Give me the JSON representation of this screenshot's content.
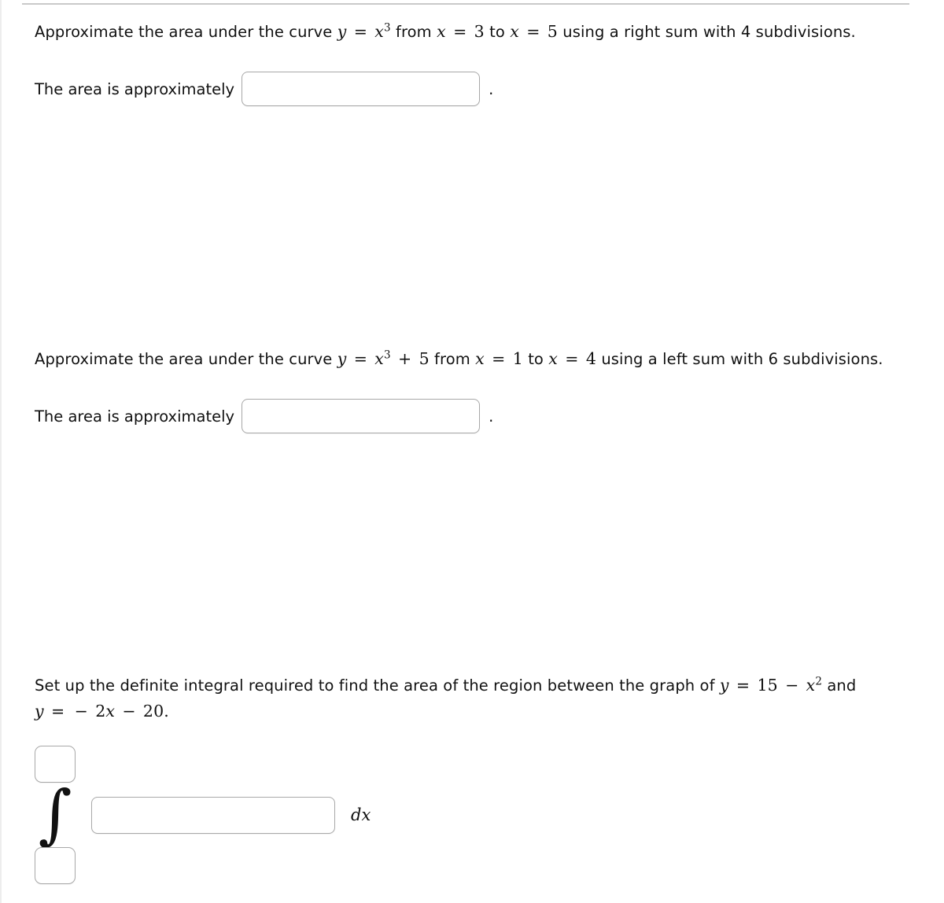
{
  "page": {
    "background_color": "#ffffff",
    "text_color": "#111111",
    "border_color": "#a8a8a8"
  },
  "questions": [
    {
      "id": "q1",
      "prompt_parts": {
        "lead": "Approximate the area under the curve",
        "function_y": "y",
        "equals": "=",
        "function_base": "x",
        "function_exponent": "3",
        "from": "from",
        "var_from": "x",
        "from_value": "3",
        "to": "to",
        "var_to": "x",
        "to_value": "5",
        "tail": "using a right sum with 4 subdivisions."
      },
      "answer_label": "The area is approximately",
      "answer_value": "",
      "answer_placeholder": "",
      "trailing_period": "."
    },
    {
      "id": "q2",
      "prompt_parts": {
        "lead": "Approximate the area under the curve",
        "function_y": "y",
        "equals": "=",
        "function_base": "x",
        "function_exponent": "3",
        "plus": "+",
        "constant": "5",
        "from": "from",
        "var_from": "x",
        "from_value": "1",
        "to": "to",
        "var_to": "x",
        "to_value": "4",
        "tail": "using a left sum with 6 subdivisions."
      },
      "answer_label": "The area is approximately",
      "answer_value": "",
      "answer_placeholder": "",
      "trailing_period": "."
    }
  ],
  "integral_question": {
    "id": "q3",
    "prompt_parts": {
      "lead": "Set up the definite integral required to find the area of the region between the graph of",
      "curve1_y": "y",
      "equals1": "=",
      "curve1_const": "15",
      "minus1": "−",
      "curve1_base": "x",
      "curve1_exponent": "2",
      "and": "and",
      "curve2_y": "y",
      "equals2": "=",
      "curve2_minus": "−",
      "curve2_coeff": "2",
      "curve2_var": "x",
      "curve2_minus2": "−",
      "curve2_const": "20",
      "period": "."
    },
    "upper_limit_value": "",
    "upper_limit_placeholder": "",
    "lower_limit_value": "",
    "lower_limit_placeholder": "",
    "integral_symbol": "∫",
    "integrand_value": "",
    "integrand_placeholder": "",
    "differential_label": "dx"
  }
}
